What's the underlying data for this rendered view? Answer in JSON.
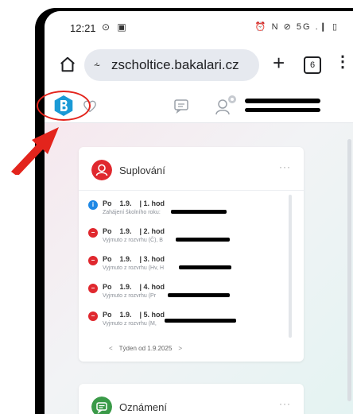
{
  "status_bar": {
    "time": "12:21",
    "left_icons": "⊙ ▣",
    "right_icons": "⏰ N ⊘ 5G .❙ ▯"
  },
  "browser": {
    "url": "zscholtice.bakalari.cz",
    "url_tune_glyph": "⸞",
    "new_tab_glyph": "+",
    "tab_count": "6",
    "menu_glyph": "⋮"
  },
  "cards": {
    "substitutions": {
      "title": "Suplování",
      "menu_glyph": "···",
      "rows": [
        {
          "day": "Po",
          "date": "1.9.",
          "hour": "| 1. hod",
          "note": "Zahájení školního roku:",
          "kind": "info"
        },
        {
          "day": "Po",
          "date": "1.9.",
          "hour": "| 2. hod",
          "note": "Vyjmuto z rozvrhu (Č), B",
          "kind": "cancel"
        },
        {
          "day": "Po",
          "date": "1.9.",
          "hour": "| 3. hod",
          "note": "Vyjmuto z rozvrhu (Hv, H",
          "kind": "cancel"
        },
        {
          "day": "Po",
          "date": "1.9.",
          "hour": "| 4. hod",
          "note": "Vyjmuto z rozvrhu (Pr",
          "kind": "cancel"
        },
        {
          "day": "Po",
          "date": "1.9.",
          "hour": "| 5. hod",
          "note": "Vyjmuto z rozvrhu (M,",
          "kind": "cancel"
        }
      ],
      "week_label": "Týden od 1.9.2025",
      "prev_glyph": "<",
      "next_glyph": ">"
    },
    "announcements": {
      "title": "Oznámení",
      "menu_glyph": "···"
    }
  },
  "colors": {
    "info_dot": "#1e88e5",
    "cancel_dot": "#e0282e",
    "substitutions_icon": "#e0282e",
    "announcements_icon": "#3a9a48",
    "callout": "#e3241c"
  },
  "icons": {
    "home": "home-icon",
    "tune": "tune-icon",
    "plus": "plus-icon",
    "tabs": "tabs-icon",
    "menu": "more-vert-icon",
    "logo": "bakalari-logo-icon",
    "heart": "heart-icon",
    "message": "message-icon",
    "user": "user-icon"
  }
}
